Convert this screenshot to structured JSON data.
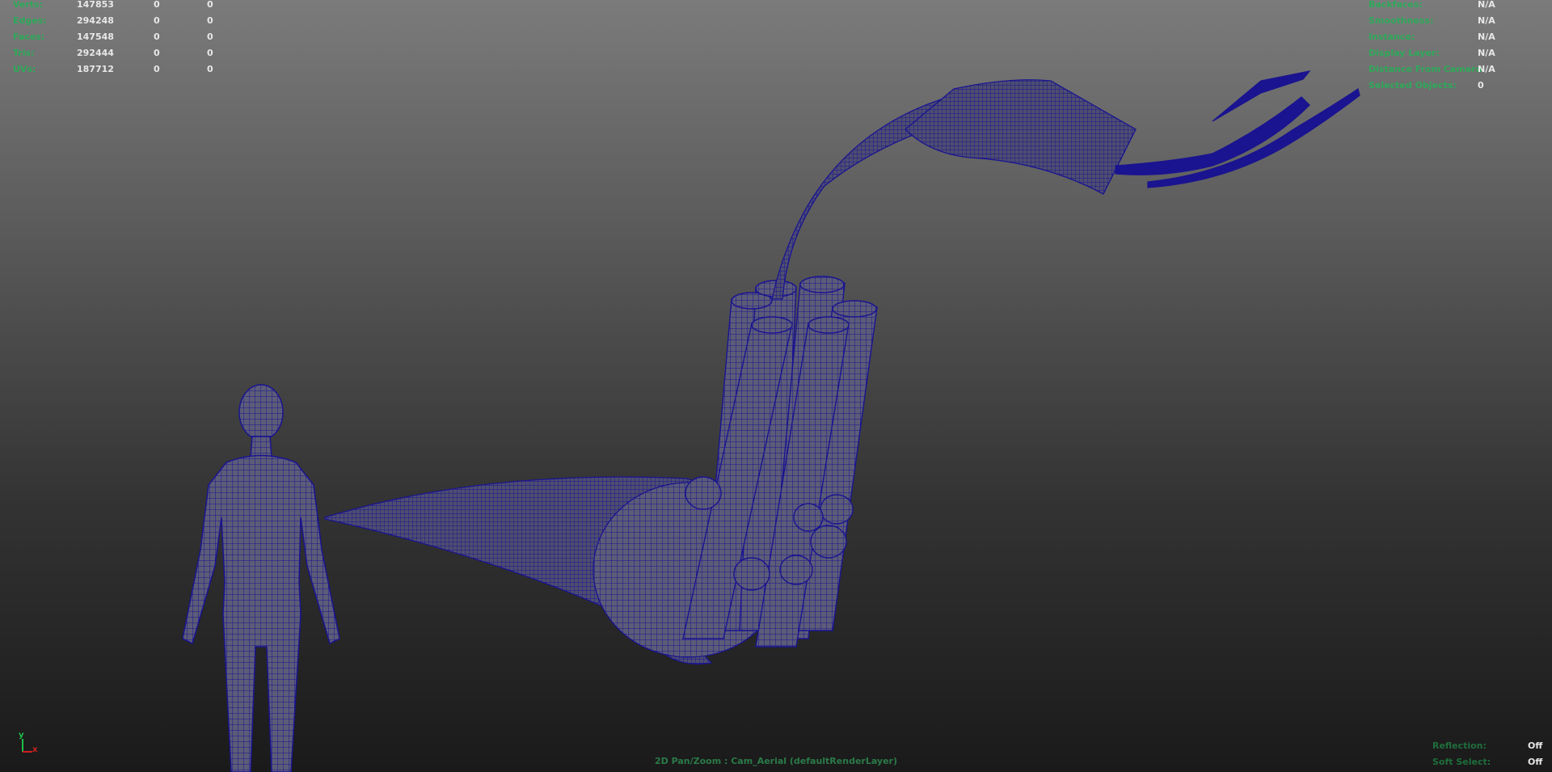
{
  "stats_left": [
    {
      "label": "Verts:",
      "values": [
        "147853",
        "0",
        "0"
      ]
    },
    {
      "label": "Edges:",
      "values": [
        "294248",
        "0",
        "0"
      ]
    },
    {
      "label": "Faces:",
      "values": [
        "147548",
        "0",
        "0"
      ]
    },
    {
      "label": "Tris:",
      "values": [
        "292444",
        "0",
        "0"
      ]
    },
    {
      "label": "UVs:",
      "values": [
        "187712",
        "0",
        "0"
      ]
    }
  ],
  "stats_right": [
    {
      "label": "Backfaces:",
      "value": "N/A"
    },
    {
      "label": "Smoothness:",
      "value": "N/A"
    },
    {
      "label": "Instance:",
      "value": "N/A"
    },
    {
      "label": "Display Layer:",
      "value": "N/A"
    },
    {
      "label": "Distance From Camera:",
      "value": "N/A"
    },
    {
      "label": "Selected Objects:",
      "value": "0"
    }
  ],
  "stats_bottom_right": [
    {
      "label": "Reflection:",
      "value": "Off"
    },
    {
      "label": "Soft Select:",
      "value": "Off"
    }
  ],
  "viewport_caption": "2D Pan/Zoom : Cam_Aerial (defaultRenderLayer)",
  "axis": {
    "y": "y",
    "x": "x"
  },
  "colors": {
    "wire": "#1a1490",
    "label": "#2ea95a",
    "value": "#e8e8e8",
    "axis_y": "#1fbf4a",
    "axis_x": "#d02020"
  }
}
